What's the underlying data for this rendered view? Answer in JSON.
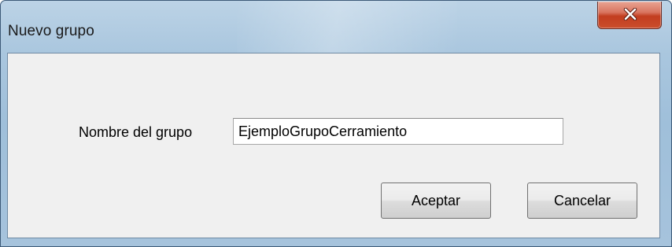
{
  "window": {
    "title": "Nuevo grupo",
    "close_icon": "close-x-icon"
  },
  "form": {
    "group_name_label": "Nombre del grupo",
    "group_name_value": "EjemploGrupoCerramiento"
  },
  "buttons": {
    "accept_label": "Aceptar",
    "cancel_label": "Cancelar"
  },
  "colors": {
    "title_bar": "#a9c6de",
    "close_button": "#c23d1f",
    "client_background": "#f0f0f0"
  }
}
